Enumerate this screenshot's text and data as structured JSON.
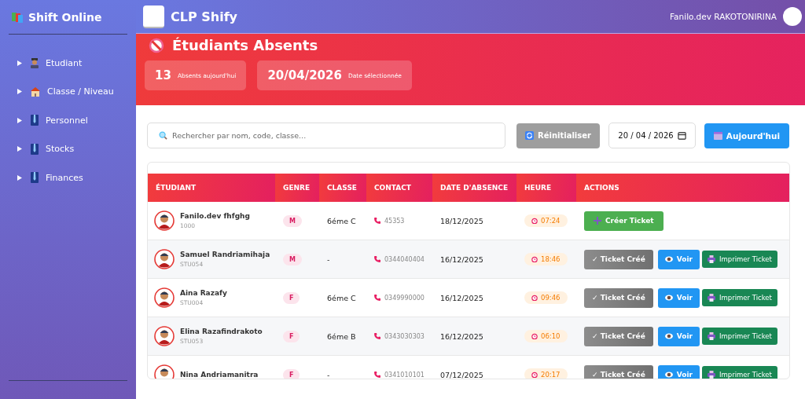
{
  "sidebar": {
    "title": "Shift Online",
    "items": [
      {
        "label": "Etudiant",
        "kind": "student"
      },
      {
        "label": "Classe / Niveau",
        "kind": "school"
      },
      {
        "label": "Personnel",
        "kind": "staff"
      },
      {
        "label": "Stocks",
        "kind": "staff"
      },
      {
        "label": "Finances",
        "kind": "staff"
      }
    ]
  },
  "topbar": {
    "title": "CLP Shify",
    "user": "Fanilo.dev RAKOTONIRINA"
  },
  "header": {
    "title": "Étudiants Absents",
    "stats": [
      {
        "value": "13",
        "label": "Absents aujourd'hui"
      },
      {
        "value": "20/04/2026",
        "label": "Date sélectionnée"
      }
    ]
  },
  "filters": {
    "search_placeholder": "Rechercher par nom, code, classe...",
    "reset_button": "Réinitialiser",
    "date": "20 / 04 / 2026",
    "today_button": "Aujourd'hui"
  },
  "table": {
    "columns": [
      "ÉTUDIANT",
      "GENRE",
      "CLASSE",
      "CONTACT",
      "DATE D'ABSENCE",
      "HEURE",
      "ACTIONS"
    ],
    "rows": [
      {
        "name": "Fanilo.dev fhfghg",
        "code": "1000",
        "gender": "M",
        "class": "6éme C",
        "contact": "45353",
        "date": "18/12/2025",
        "time": "07:24",
        "ticket_created": false,
        "actions": [
          "Créer Ticket"
        ]
      },
      {
        "name": "Samuel Randriamihaja",
        "code": "STU054",
        "gender": "M",
        "class": "-",
        "contact": "0344040404",
        "date": "16/12/2025",
        "time": "18:46",
        "ticket_created": true,
        "actions": [
          "✓ Ticket Créé",
          "Voir",
          "Imprimer Ticket"
        ]
      },
      {
        "name": "Aina Razafy",
        "code": "STU004",
        "gender": "F",
        "class": "6éme C",
        "contact": "0349990000",
        "date": "16/12/2025",
        "time": "09:46",
        "ticket_created": true,
        "actions": [
          "✓ Ticket Créé",
          "Voir",
          "Imprimer Ticket"
        ]
      },
      {
        "name": "Elina Razafindrakoto",
        "code": "STU053",
        "gender": "F",
        "class": "6éme B",
        "contact": "0343030303",
        "date": "16/12/2025",
        "time": "06:10",
        "ticket_created": true,
        "actions": [
          "✓ Ticket Créé",
          "Voir",
          "Imprimer Ticket"
        ]
      },
      {
        "name": "Nina Andriamanitra",
        "gender": "F",
        "class": "-",
        "contact": "0341010101",
        "date": "07/12/2025",
        "time": "20:17",
        "ticket_created": true,
        "actions": [
          "✓ Ticket Créé",
          "Voir",
          "Imprimer Ticket"
        ]
      }
    ]
  }
}
